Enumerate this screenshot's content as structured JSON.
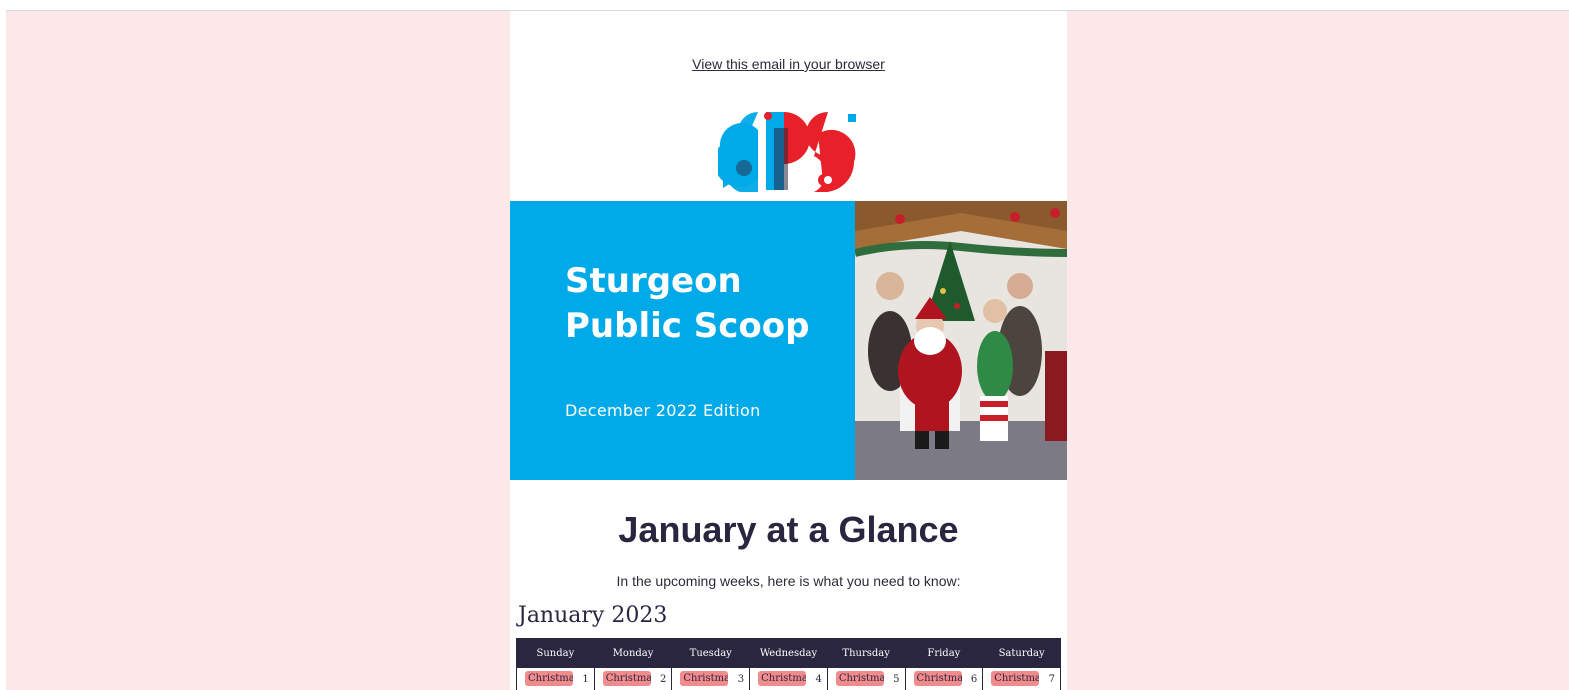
{
  "email": {
    "view_in_browser": "View this email in your browser",
    "logo_text": "SPS",
    "hero": {
      "title": "Sturgeon Public Scoop",
      "subtitle": "December 2022 Edition"
    },
    "section_title": "January at a Glance",
    "intro": "In the upcoming weeks, here is what you need to know:",
    "calendar": {
      "title": "January 2023",
      "weekdays": [
        "Sunday",
        "Monday",
        "Tuesday",
        "Wednesday",
        "Thursday",
        "Friday",
        "Saturday"
      ],
      "days": [
        {
          "num": "1",
          "event": "Christmas"
        },
        {
          "num": "2",
          "event": "Christmas"
        },
        {
          "num": "3",
          "event": "Christmas"
        },
        {
          "num": "4",
          "event": "Christmas"
        },
        {
          "num": "5",
          "event": "Christmas"
        },
        {
          "num": "6",
          "event": "Christmas"
        },
        {
          "num": "7",
          "event": "Christmas"
        }
      ]
    }
  },
  "colors": {
    "page_background": "#fce8e8",
    "hero_blue": "#00a9e8",
    "navy": "#2a2640",
    "event_pink": "#f28b8b",
    "logo_red": "#e8202a"
  }
}
